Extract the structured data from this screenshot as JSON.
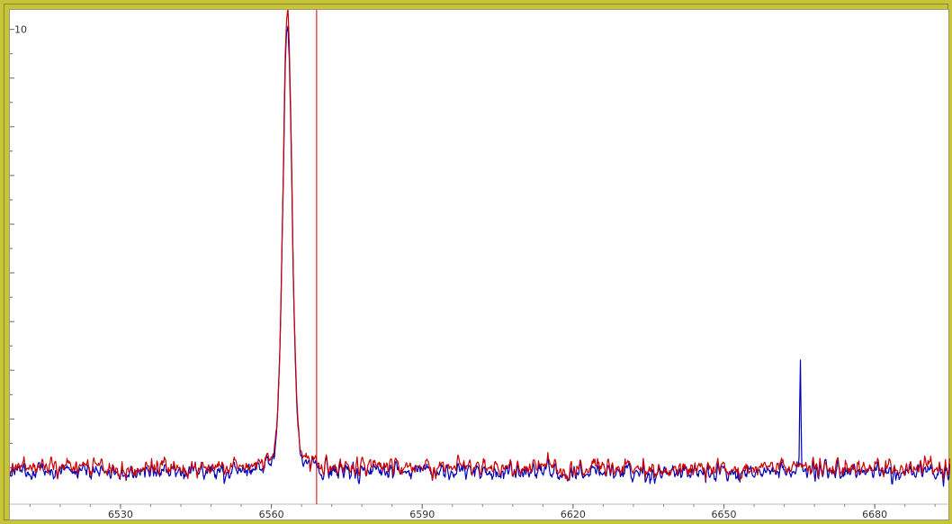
{
  "chart_data": {
    "type": "line",
    "title": "",
    "xlabel": "",
    "ylabel": "",
    "xlim": [
      6508,
      6695
    ],
    "ylim": [
      0.25,
      10.4
    ],
    "x_ticks": [
      6530,
      6560,
      6590,
      6620,
      6650,
      6680
    ],
    "x_tick_labels": [
      "6530",
      "6560",
      "6590",
      "6620",
      "6650",
      "6680"
    ],
    "y_ticks": [
      10
    ],
    "y_tick_labels": [
      "10"
    ],
    "grid": false,
    "cursor_x": 6569,
    "series": [
      {
        "color": "#cc0000",
        "baseline": 1.0,
        "noise": 0.28,
        "peaks": [
          {
            "x": 6563.2,
            "height": 8.95,
            "width": 0.9
          }
        ]
      },
      {
        "color": "#0000bb",
        "baseline": 0.92,
        "noise": 0.28,
        "peaks": [
          {
            "x": 6563.2,
            "height": 8.85,
            "width": 0.9
          },
          {
            "x": 6665.2,
            "height": 2.35,
            "width": 0.12
          }
        ]
      }
    ],
    "colors": {
      "frame": "#c8c43a",
      "background": "#ffffff",
      "cursor": "#cc0000"
    }
  }
}
